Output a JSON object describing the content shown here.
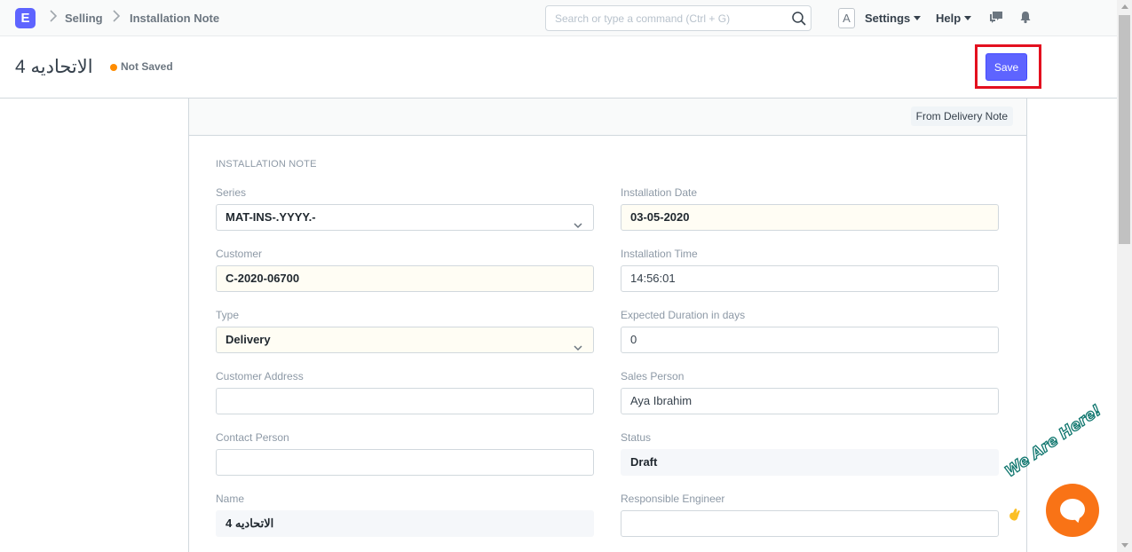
{
  "navbar": {
    "logo": "E",
    "breadcrumbs": [
      "Selling",
      "Installation Note"
    ],
    "search_placeholder": "Search or type a command (Ctrl + G)",
    "avatar": "A",
    "settings_label": "Settings",
    "help_label": "Help"
  },
  "page": {
    "title": "الاتحاديه 4",
    "status": "Not Saved",
    "save_label": "Save"
  },
  "form": {
    "toolbar_button": "From Delivery Note",
    "section": "INSTALLATION NOTE",
    "fields_left": [
      {
        "label": "Series",
        "value": "MAT-INS-.YYYY.-"
      },
      {
        "label": "Customer",
        "value": "C-2020-06700"
      },
      {
        "label": "Type",
        "value": "Delivery"
      },
      {
        "label": "Customer Address",
        "value": ""
      },
      {
        "label": "Contact Person",
        "value": ""
      },
      {
        "label": "Name",
        "value": "الاتحاديه 4"
      }
    ],
    "fields_right": [
      {
        "label": "Installation Date",
        "value": "03-05-2020"
      },
      {
        "label": "Installation Time",
        "value": "14:56:01"
      },
      {
        "label": "Expected Duration in days",
        "value": "0"
      },
      {
        "label": "Sales Person",
        "value": "Aya Ibrahim"
      },
      {
        "label": "Status",
        "value": "Draft"
      },
      {
        "label": "Responsible Engineer",
        "value": ""
      }
    ]
  },
  "chat": {
    "banner": "We Are Here!"
  },
  "colors": {
    "primary": "#5e64ff",
    "highlight": "#e3101f",
    "status_dot": "#ff8c00",
    "chat": "#f97316"
  }
}
